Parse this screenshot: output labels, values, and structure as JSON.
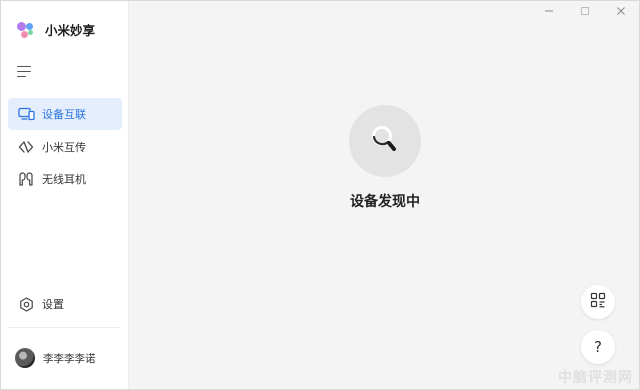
{
  "app": {
    "name": "小米妙享",
    "logo_colors": [
      "#b57cf0",
      "#5ea3f5",
      "#f18fae",
      "#78d6a0"
    ]
  },
  "sidebar": {
    "menu_icon": "hamburger-menu-icon",
    "items": [
      {
        "label": "设备互联",
        "icon": "monitor-devices-icon",
        "active": true
      },
      {
        "label": "小米互传",
        "icon": "transfer-arrows-icon",
        "active": false
      },
      {
        "label": "无线耳机",
        "icon": "earbuds-icon",
        "active": false
      }
    ],
    "settings": {
      "label": "设置",
      "icon": "settings-hexagon-icon"
    },
    "user": {
      "name": "李李李李诺",
      "avatar": "user-avatar"
    }
  },
  "window_controls": [
    "minimize-icon",
    "maximize-icon",
    "close-icon"
  ],
  "main": {
    "status": "设备发现中",
    "scan_icon": "search-magnifier-icon",
    "fabs": [
      {
        "icon": "scan-qr-icon"
      },
      {
        "icon": "help-icon",
        "label": "?"
      }
    ]
  },
  "watermark": "中脑评测网",
  "colors": {
    "accent": "#2b73e0",
    "active_bg": "#e4eefc",
    "main_bg": "#f4f4f4",
    "sidebar_bg": "#ffffff"
  }
}
